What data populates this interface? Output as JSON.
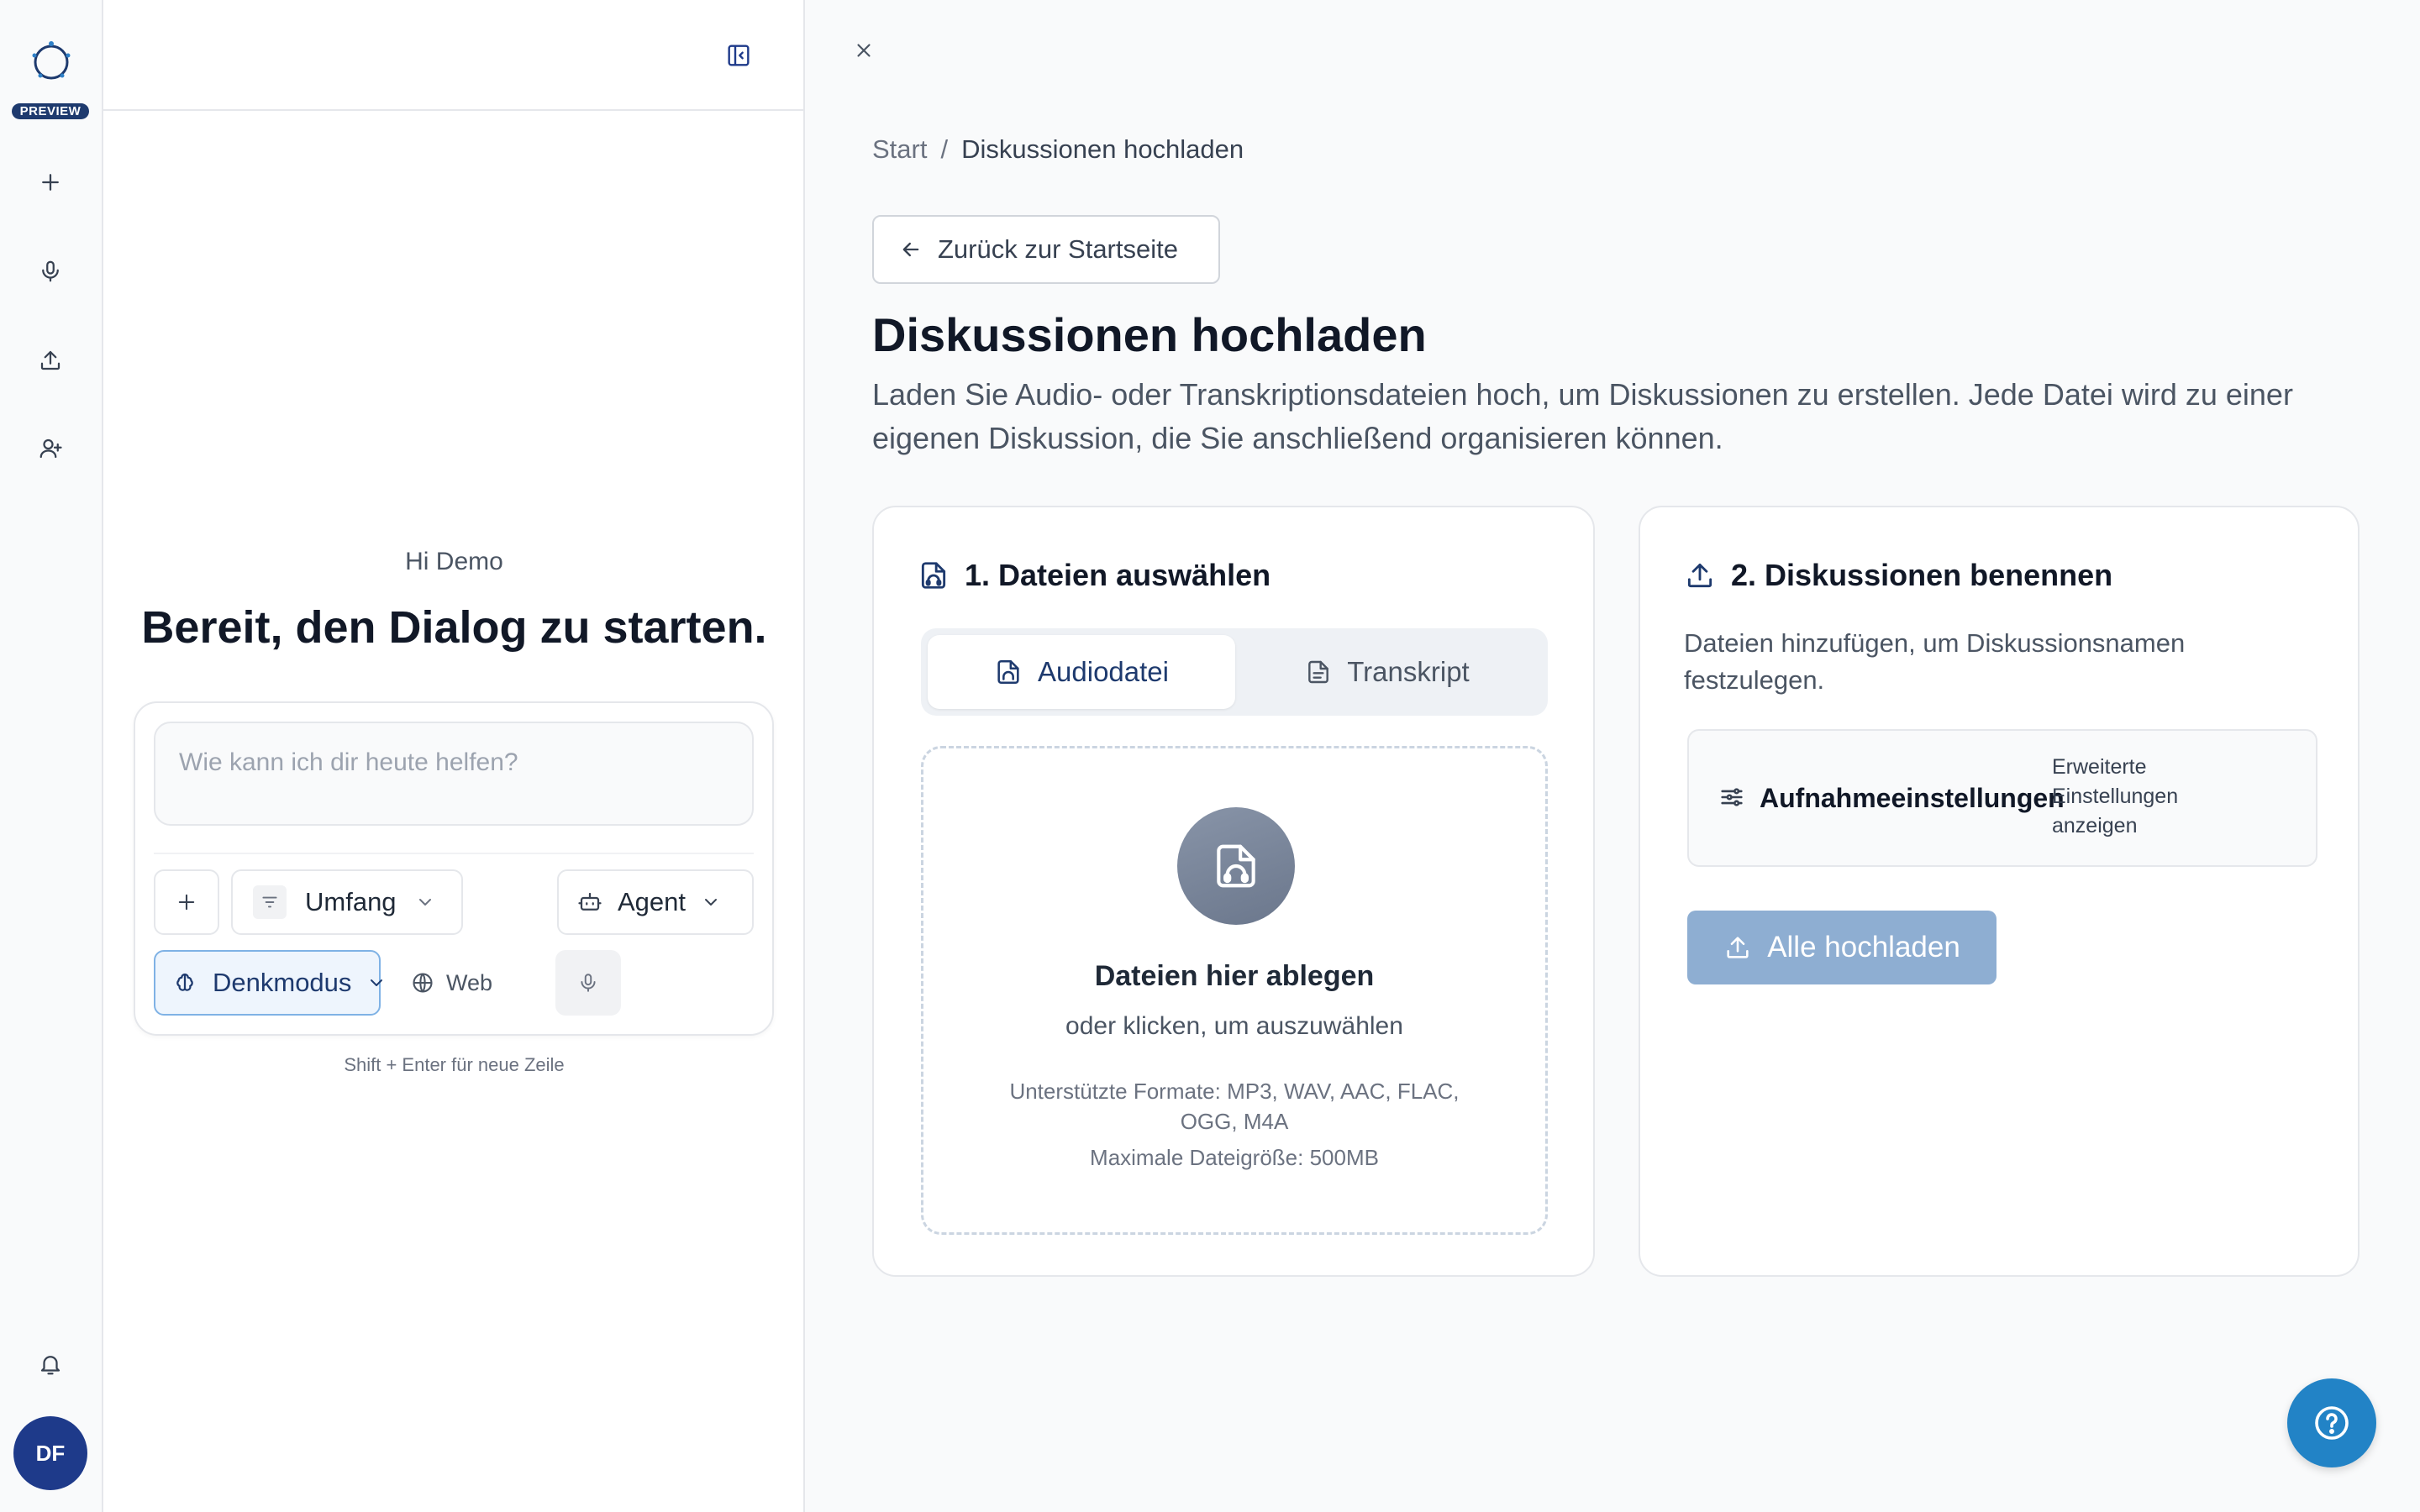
{
  "rail": {
    "preview_badge": "PREVIEW",
    "avatar_initials": "DF",
    "icons": [
      "app-logo-icon",
      "plus-icon",
      "microphone-icon",
      "upload-icon",
      "user-plus-icon",
      "bell-icon"
    ]
  },
  "chat": {
    "greeting_small": "Hi Demo",
    "greeting_big": "Bereit, den Dialog zu starten.",
    "input_placeholder": "Wie kann ich dir heute helfen?",
    "scope_label": "Umfang",
    "agent_label": "Agent",
    "think_label": "Denkmodus",
    "web_label": "Web",
    "hint": "Shift + Enter für neue Zeile"
  },
  "breadcrumb": {
    "home": "Start",
    "separator": "/",
    "current": "Diskussionen hochladen"
  },
  "main": {
    "back_label": "Zurück zur Startseite",
    "title": "Diskussionen hochladen",
    "lead": "Laden Sie Audio- oder Transkriptionsdateien hoch, um Diskussionen zu erstellen. Jede Datei wird zu einer eigenen Diskussion, die Sie anschließend organisieren können."
  },
  "step1": {
    "title": "1. Dateien auswählen",
    "tab_audio": "Audiodatei",
    "tab_transcript": "Transkript",
    "drop_title": "Dateien hier ablegen",
    "drop_sub": "oder klicken, um auszuwählen",
    "formats": "Unterstützte Formate: MP3, WAV, AAC, FLAC, OGG, M4A",
    "max_size": "Maximale Dateigröße: 500MB"
  },
  "step2": {
    "title": "2. Diskussionen benennen",
    "text": "Dateien hinzufügen, um Diskussionsnamen festzulegen.",
    "settings_label": "Aufnahmeeinstellungen",
    "advanced_label": "Erweiterte Einstellungen anzeigen",
    "upload_all": "Alle hochladen"
  },
  "colors": {
    "brand_navy": "#1e3a6e",
    "upload_btn_disabled": "#8eaed2",
    "help_fab": "#2283c6",
    "think_active_bg": "#eef5fd"
  }
}
